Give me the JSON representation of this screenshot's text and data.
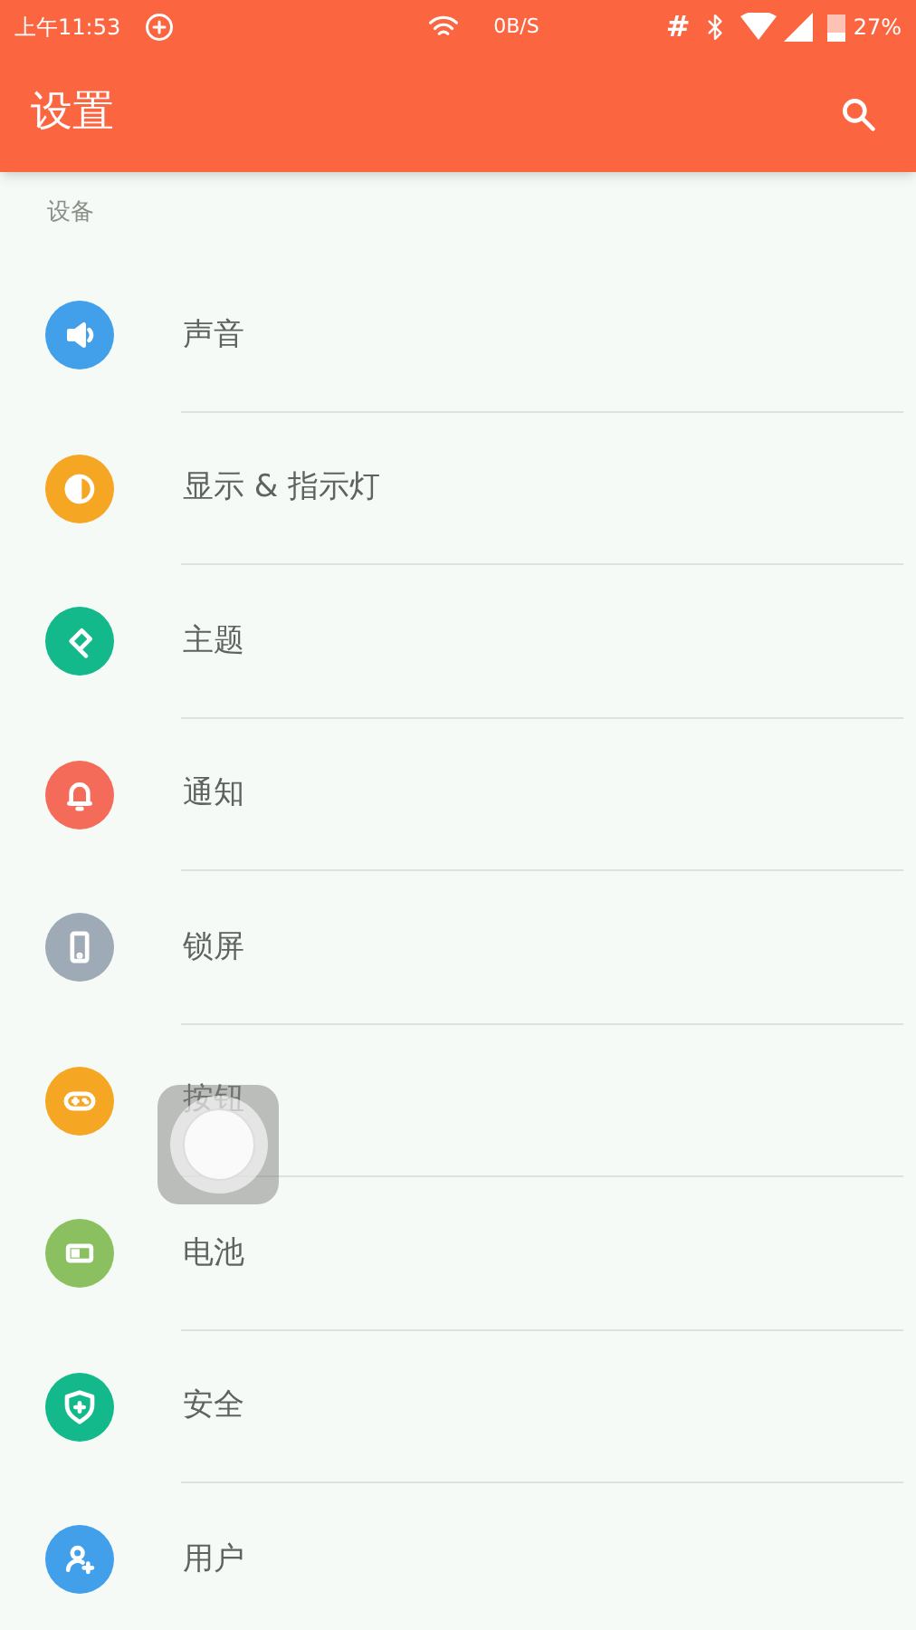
{
  "status_bar": {
    "time": "上午11:53",
    "speed": "0B/S",
    "hash": "#",
    "battery": "27%"
  },
  "app_bar": {
    "title": "设置"
  },
  "section": {
    "header": "设备"
  },
  "items": [
    {
      "label": "声音",
      "kind": "sound",
      "color": "#42a0ea"
    },
    {
      "label": "显示 & 指示灯",
      "kind": "display",
      "color": "#f5a623"
    },
    {
      "label": "主题",
      "kind": "theme",
      "color": "#13b98a"
    },
    {
      "label": "通知",
      "kind": "notification",
      "color": "#f46b5a"
    },
    {
      "label": "锁屏",
      "kind": "lockscreen",
      "color": "#9eaab5"
    },
    {
      "label": "按钮",
      "kind": "buttons",
      "color": "#f5a623"
    },
    {
      "label": "电池",
      "kind": "battery",
      "color": "#8bc061"
    },
    {
      "label": "安全",
      "kind": "security",
      "color": "#13b98a"
    },
    {
      "label": "用户",
      "kind": "user",
      "color": "#42a0ea"
    }
  ]
}
